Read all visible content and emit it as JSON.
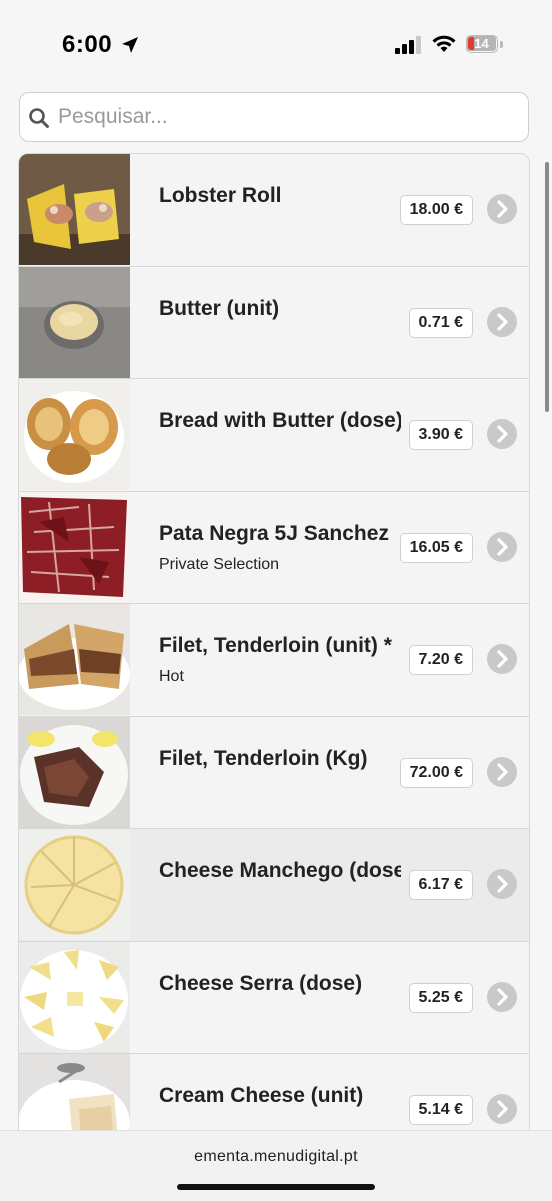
{
  "status": {
    "time": "6:00",
    "battery": "14"
  },
  "search": {
    "placeholder": "Pesquisar..."
  },
  "items": [
    {
      "name": "Lobster Roll",
      "subtitle": "",
      "price": "18.00 €"
    },
    {
      "name": "Butter (unit)",
      "subtitle": "",
      "price": "0.71 €"
    },
    {
      "name": "Bread with Butter (dose)",
      "subtitle": "",
      "price": "3.90 €"
    },
    {
      "name": "Pata Negra 5J Sanchez",
      "subtitle": "Private Selection",
      "price": "16.05 €"
    },
    {
      "name": "Filet, Tenderloin (unit) *",
      "subtitle": "Hot",
      "price": "7.20 €"
    },
    {
      "name": "Filet, Tenderloin (Kg)",
      "subtitle": "",
      "price": "72.00 €"
    },
    {
      "name": "Cheese Manchego (dose)",
      "subtitle": "",
      "price": "6.17 €"
    },
    {
      "name": "Cheese Serra (dose)",
      "subtitle": "",
      "price": "5.25 €"
    },
    {
      "name": "Cream Cheese (unit)",
      "subtitle": "",
      "price": "5.14 €"
    }
  ],
  "browser": {
    "url": "ementa.menudigital.pt"
  }
}
